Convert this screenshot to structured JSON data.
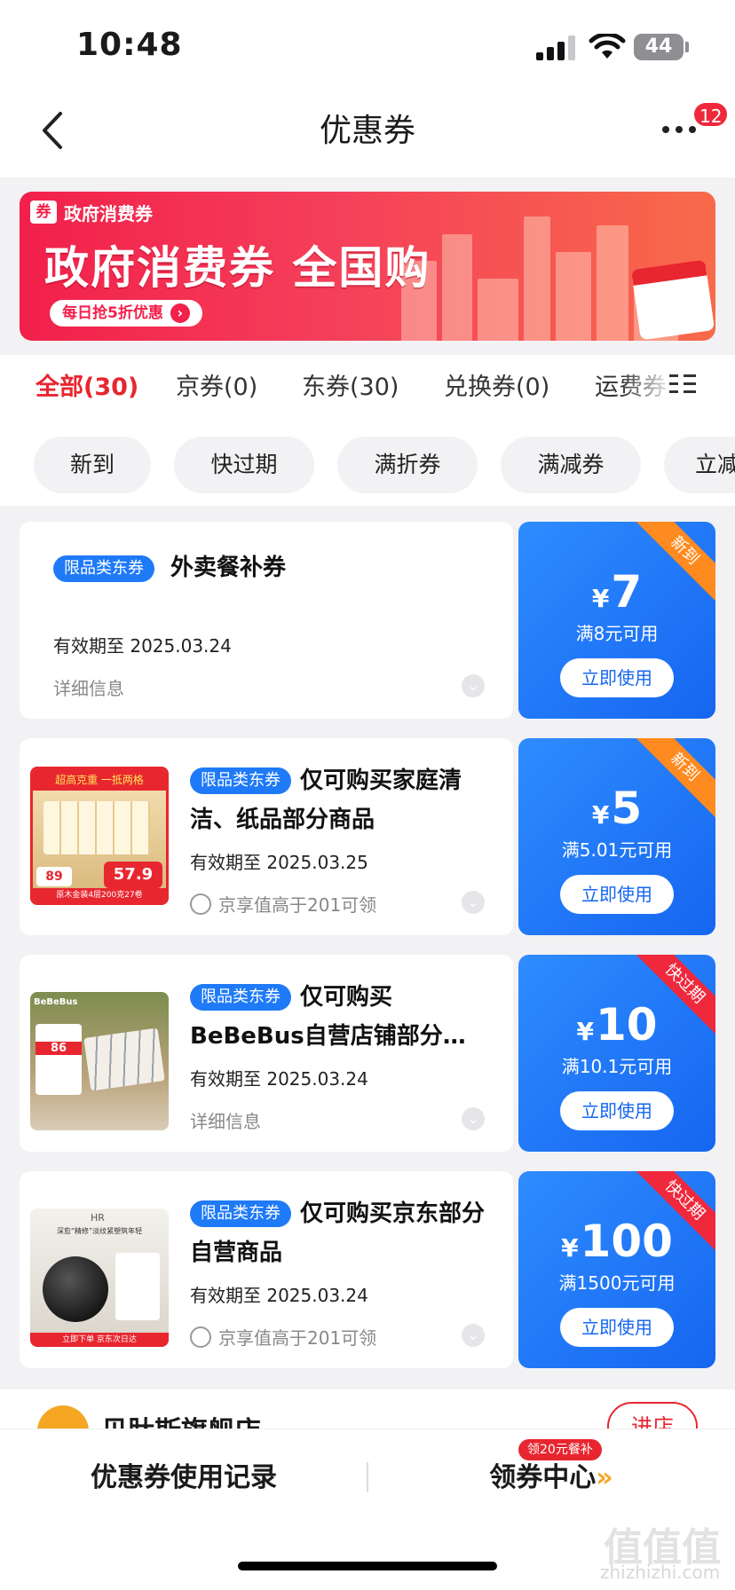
{
  "status": {
    "time": "10:48",
    "battery": "44"
  },
  "nav": {
    "title": "优惠券",
    "more_badge": "12"
  },
  "banner": {
    "tag": "政府消费券",
    "tag_icon": "券",
    "headline": "政府消费券 全国购",
    "pill": "每日抢5折优惠"
  },
  "tabs": [
    "全部(30)",
    "京券(0)",
    "东券(30)",
    "兑换券(0)",
    "运费券"
  ],
  "chips": [
    "新到",
    "快过期",
    "满折券",
    "满减券",
    "立减"
  ],
  "coupons": [
    {
      "tag": "限品类东券",
      "title": "外卖餐补券",
      "expiry": "有效期至 2025.03.24",
      "info": "详细信息",
      "amount": "7",
      "condition": "满8元可用",
      "button": "立即使用",
      "corner": "新到"
    },
    {
      "tag": "限品类东券",
      "title": "仅可购买家庭清洁、纸品部分商品",
      "expiry": "有效期至 2025.03.25",
      "info": "京享值高于201可领",
      "amount": "5",
      "condition": "满5.01元可用",
      "button": "立即使用",
      "corner": "新到",
      "thumb_text": [
        "超高克重 一抵两格",
        "原木金装4层200克27卷",
        "89",
        "57.9"
      ]
    },
    {
      "tag": "限品类东券",
      "title": "仅可购买BeBeBus自营店铺部分…",
      "expiry": "有效期至 2025.03.24",
      "info": "详细信息",
      "amount": "10",
      "condition": "满10.1元可用",
      "button": "立即使用",
      "corner": "快过期",
      "thumb_text": [
        "BeBeBus",
        "86"
      ]
    },
    {
      "tag": "限品类东券",
      "title": "仅可购买京东部分自营商品",
      "expiry": "有效期至 2025.03.24",
      "info": "京享值高于201可领",
      "amount": "100",
      "condition": "满1500元可用",
      "button": "立即使用",
      "corner": "快过期",
      "thumb_text": [
        "HR",
        "深愈“精修”淡纹紧塑筑年轻",
        "立即下单 京东次日达"
      ]
    }
  ],
  "yen": "¥",
  "store": {
    "name": "贝肽斯旗舰店",
    "button": "进店"
  },
  "bottom": {
    "records": "优惠券使用记录",
    "center": "领券中心",
    "center_badge": "领20元餐补"
  },
  "watermark": {
    "big": "值值值",
    "small": "zhizhizhi.com"
  },
  "colors": {
    "accent_red": "#e8262f",
    "coupon_blue": "#1f7af7",
    "new_orange": "#ff8a1f",
    "expiring_red": "#f0283c"
  }
}
